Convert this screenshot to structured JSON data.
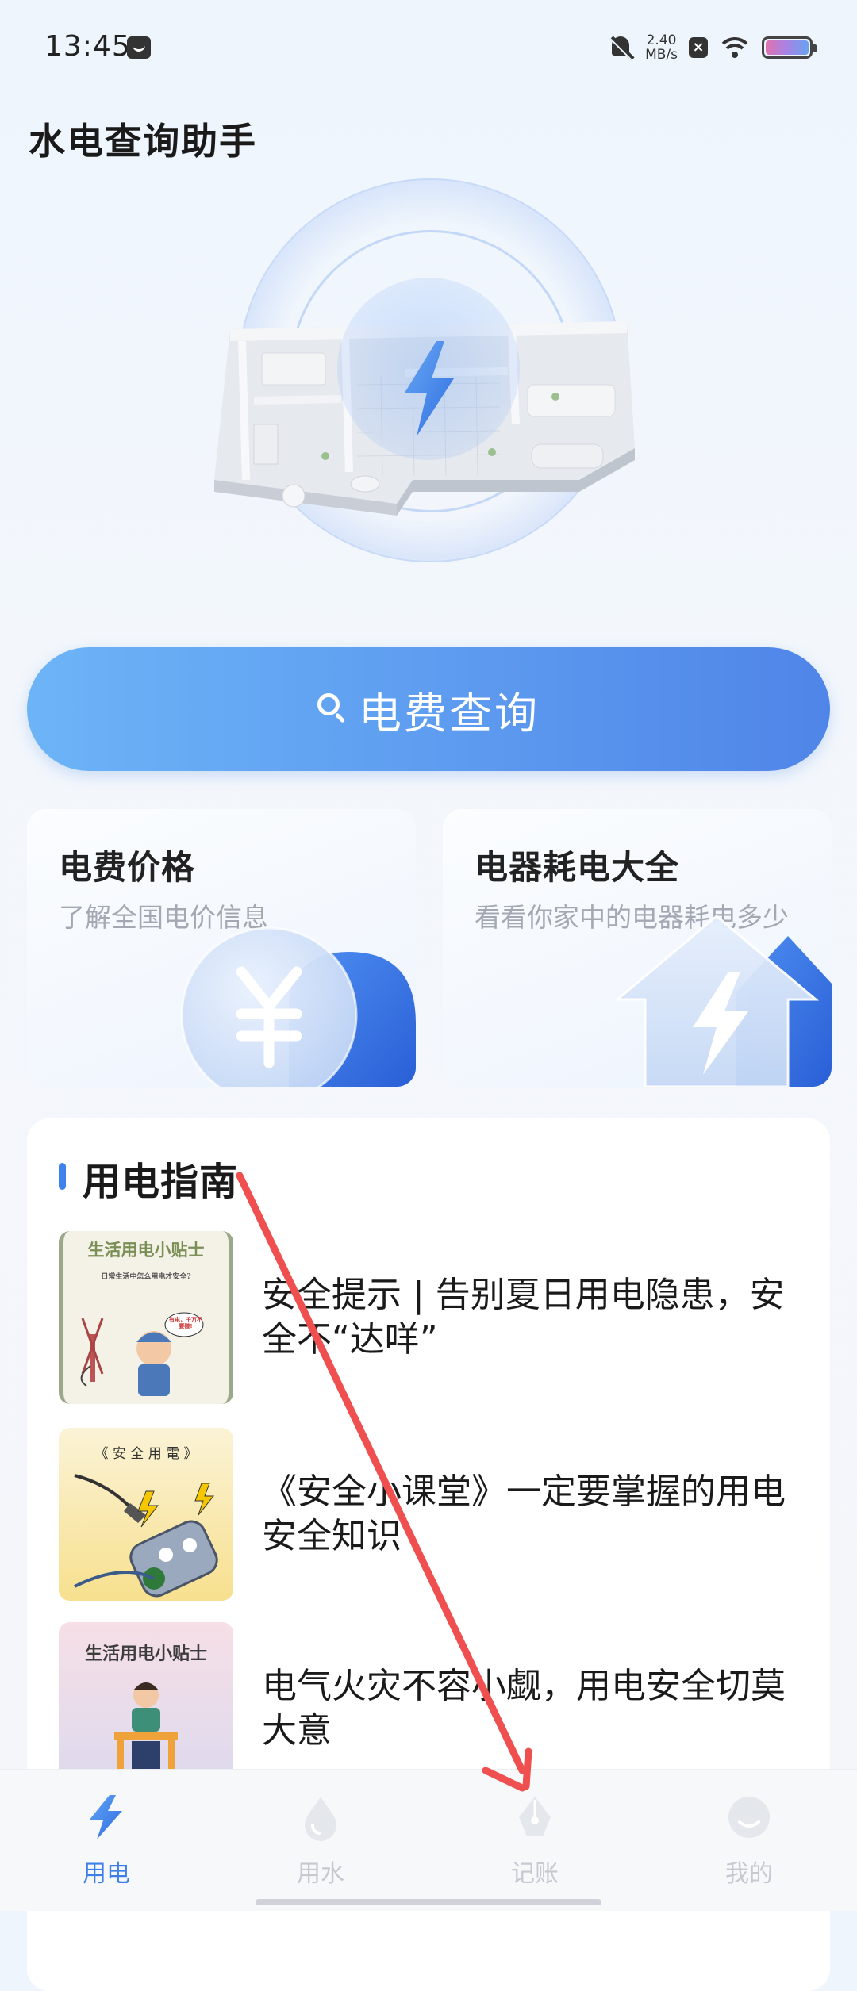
{
  "status_bar": {
    "time": "13:45",
    "speed_value": "2.40",
    "speed_unit": "MB/s",
    "icons": [
      "mail-icon",
      "bell-muted-icon",
      "x-icon",
      "wifi-icon",
      "battery-icon"
    ]
  },
  "app": {
    "title": "水电查询助手"
  },
  "hero": {
    "icon": "lightning-bolt-icon"
  },
  "search": {
    "label": "电费查询",
    "icon": "search-icon"
  },
  "cards": [
    {
      "title": "电费价格",
      "subtitle": "了解全国电价信息",
      "icon": "yuan-icon"
    },
    {
      "title": "电器耗电大全",
      "subtitle": "看看你家中的电器耗电多少",
      "icon": "house-bolt-icon"
    }
  ],
  "guide": {
    "title": "用电指南",
    "articles": [
      {
        "title": "安全提示 | 告别夏日用电隐患，安全不“达咩”",
        "thumb_title": "生活用电小贴士",
        "thumb_subtitle": "日常生活中怎么用电才安全?",
        "thumb_bubble": "有电，千万不要碰!"
      },
      {
        "title": "《安全小课堂》一定要掌握的用电安全知识",
        "thumb_title": "《 安 全 用 電 》"
      },
      {
        "title": "电气火灾不容小觑，用电安全切莫大意",
        "thumb_title": "生活用电小贴士"
      }
    ]
  },
  "tabs": [
    {
      "label": "用电",
      "icon": "bolt-icon",
      "active": true
    },
    {
      "label": "用水",
      "icon": "water-drop-icon",
      "active": false
    },
    {
      "label": "记账",
      "icon": "pen-nib-icon",
      "active": false
    },
    {
      "label": "我的",
      "icon": "profile-icon",
      "active": false
    }
  ],
  "colors": {
    "accent": "#3f7fea",
    "button_gradient_start": "#6db4f7",
    "button_gradient_end": "#4f85e8",
    "annotation_arrow": "#ef4f4f",
    "tab_inactive": "#c5c9d0"
  }
}
